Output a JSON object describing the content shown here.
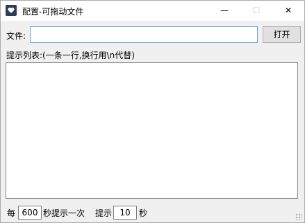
{
  "window": {
    "title": "配置-可拖动文件",
    "controls": {
      "minimize": "—",
      "maximize": "☐",
      "close": "✕"
    }
  },
  "file": {
    "label": "文件:",
    "value": "",
    "open_button": "打开"
  },
  "list": {
    "label": "提示列表:(一条一行,换行用\\n代替)",
    "content": ""
  },
  "footer": {
    "every_label": "每",
    "interval_value": "600",
    "interval_suffix": "秒提示一次",
    "show_label": "提示",
    "duration_value": "10",
    "duration_suffix": "秒"
  }
}
